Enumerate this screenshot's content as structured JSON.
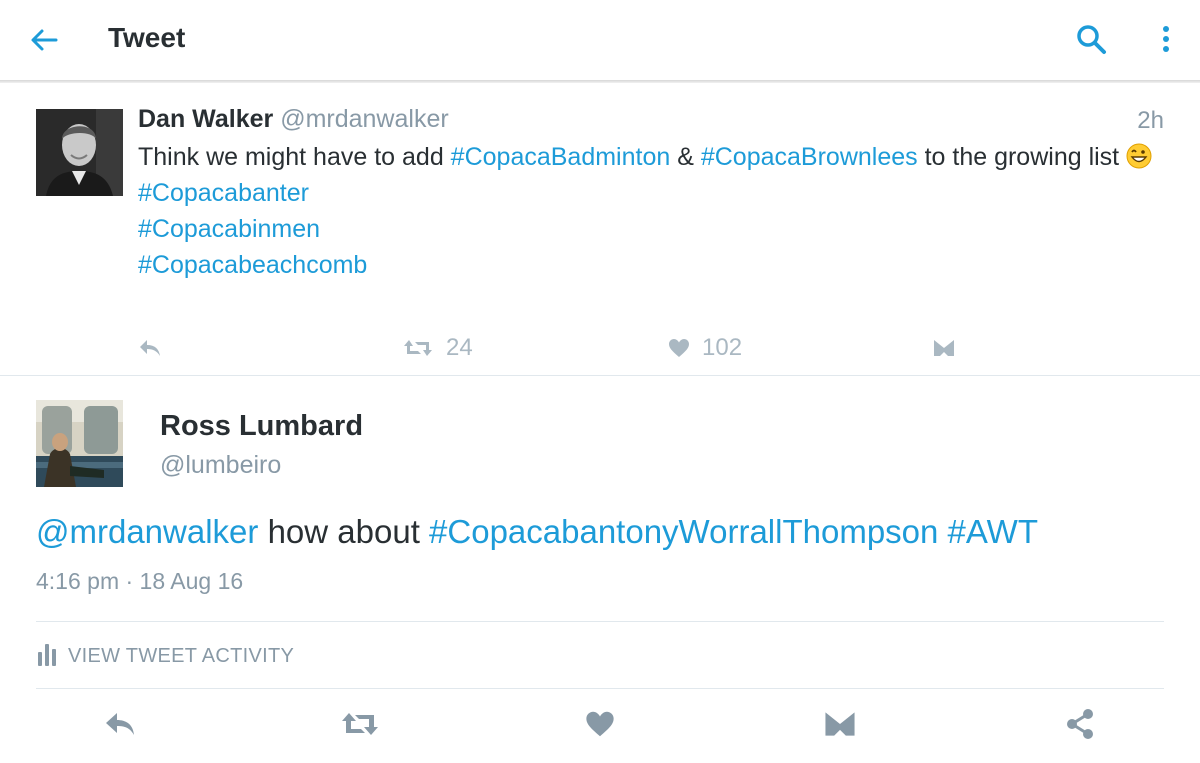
{
  "header": {
    "title": "Tweet",
    "back_icon": "arrow-left-icon",
    "search_icon": "search-icon",
    "more_icon": "more-vertical-icon",
    "accent_color": "#1d9bd8"
  },
  "parent_tweet": {
    "author_name": "Dan Walker",
    "author_handle": "@mrdanwalker",
    "time": "2h",
    "text_parts": {
      "t1": "Think we might have to add ",
      "h1": "#CopacaBadminton",
      "t2": " & ",
      "h2": "#CopacaBrownlees",
      "t3": " to the growing list "
    },
    "hashtags": [
      "#Copacabanter",
      "#Copacabinmen",
      "#Copacabeachcomb"
    ],
    "retweets": "24",
    "likes": "102"
  },
  "main_tweet": {
    "author_name": "Ross Lumbard",
    "author_handle": "@lumbeiro",
    "mention": "@mrdanwalker",
    "text_mid": " how about ",
    "hashtag1": "#CopacabantonyWorrallThompson",
    "hashtag2": "#AWT",
    "timestamp": "4:16 pm · 18 Aug 16",
    "activity_label": "VIEW TWEET ACTIVITY"
  },
  "colors": {
    "link": "#1d9bd8",
    "muted": "#8899a6",
    "icon_light": "#aab8c2",
    "text": "#292f33"
  }
}
